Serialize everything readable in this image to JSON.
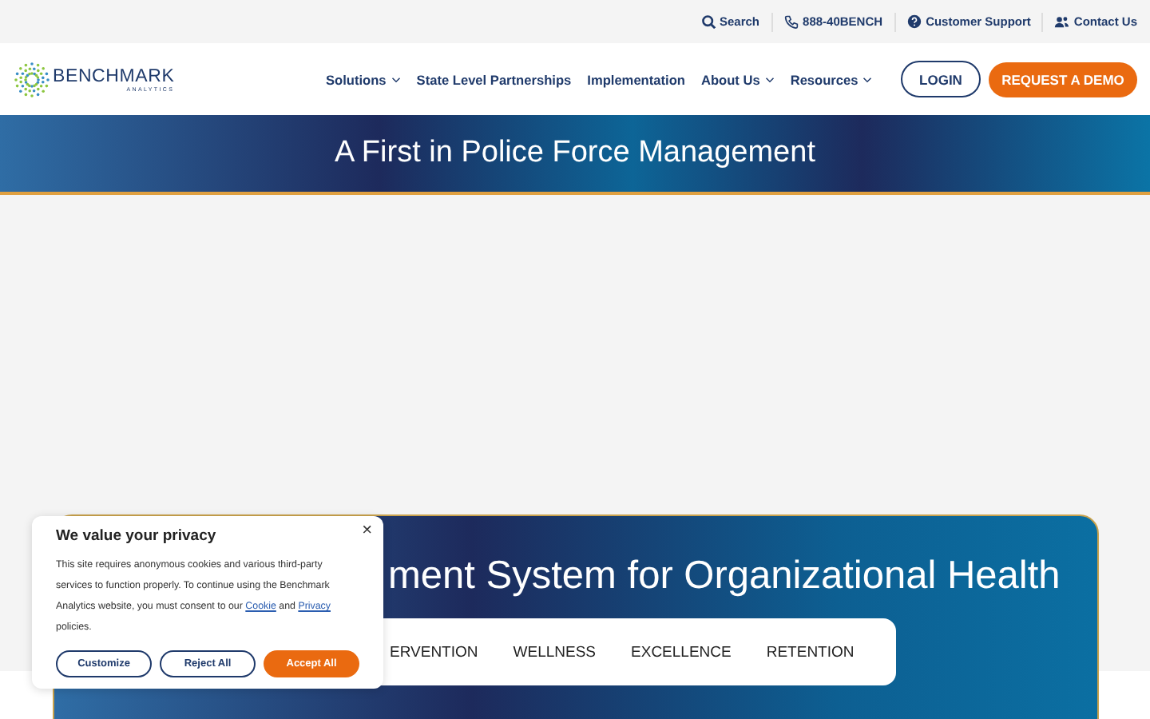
{
  "utility_bar": [
    {
      "kind": "search",
      "label": "Search"
    },
    {
      "kind": "phone",
      "label": "888-40BENCH"
    },
    {
      "kind": "help",
      "label": "Customer Support"
    },
    {
      "kind": "contact",
      "label": "Contact Us"
    }
  ],
  "logo": {
    "name": "BENCHMARK",
    "tagline": "ANALYTICS"
  },
  "nav": [
    {
      "label": "Solutions",
      "dropdown": true
    },
    {
      "label": "State Level Partnerships",
      "dropdown": false
    },
    {
      "label": "Implementation",
      "dropdown": false
    },
    {
      "label": "About Us",
      "dropdown": true
    },
    {
      "label": "Resources",
      "dropdown": true
    }
  ],
  "login_button": "LOGIN",
  "demo_button": "REQUEST A DEMO",
  "banner": {
    "title": "A First in Police Force Management"
  },
  "feature_card": {
    "heading": "ment System for Organizational Health",
    "tabs": [
      {
        "label": "ERVENTION"
      },
      {
        "label": "WELLNESS"
      },
      {
        "label": "EXCELLENCE"
      },
      {
        "label": "RETENTION"
      }
    ]
  },
  "cookie_dialog": {
    "title": "We value your privacy",
    "text": "This site requires anonymous cookies and various third-party services to function properly. To continue using the Benchmark Analytics website, you must consent to our",
    "link_1": "Cookie",
    "joiner": "and",
    "link_2": "Privacy",
    "text_end": "policies.",
    "close": "×",
    "buttons": [
      {
        "label": "Customize",
        "kind": "outline"
      },
      {
        "label": "Reject All",
        "kind": "outline"
      },
      {
        "label": "Accept All",
        "kind": "primary"
      }
    ]
  }
}
